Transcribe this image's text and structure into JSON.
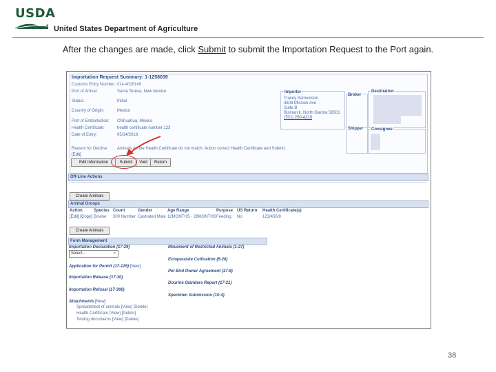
{
  "header": {
    "logo_text": "USDA",
    "agency": "United States Department of Agriculture",
    "caption_before": "After the changes are made, click ",
    "caption_link": "Submit",
    "caption_after": " to submit the Importation Request to the Port again."
  },
  "summary": {
    "title": "Importation Request Summary: 1-1258039",
    "customs": "Customs Entry Number: 014-4015149",
    "fields": [
      {
        "label": "Port of Arrival:",
        "value": "Santa Teresa, New Mexico"
      },
      {
        "label": "Status:",
        "value": "Initial"
      },
      {
        "label": "Country of Origin:",
        "value": "Mexico"
      },
      {
        "label": "Port of Embarkation:",
        "value": "Chihuahua, Mexico"
      },
      {
        "label": "Health Certificate:",
        "value": "health certificate number 123"
      },
      {
        "label": "Date of Entry:",
        "value": "05/14/2018"
      }
    ],
    "reason_label": "Reason for Decline:",
    "reason_text": "Animals on the Health Certificate do not match. Action correct Health Certificate and Submit.",
    "edit_link": "[Edit]"
  },
  "importer": {
    "label": "Importer",
    "lines": [
      "Tracey Samuelson",
      "3608 Mission Ave",
      "Suite B",
      "Bismarck, North Dakota 58501"
    ],
    "phone": "(701) 250-4210"
  },
  "parties": {
    "broker": "Broker",
    "destination": "Destination",
    "shipper": "Shipper",
    "consignee": "Consignee"
  },
  "buttons": {
    "edit": "Edit Information",
    "submit": "Submit",
    "void": "Void",
    "return": "Return",
    "create_animals_1": "Create Animals",
    "create_animals_2": "Create Animals"
  },
  "offline": {
    "title": "Off-Line Actions"
  },
  "animals": {
    "title": "Animal Groups",
    "headers": [
      "Action",
      "Species",
      "Count",
      "Gender",
      "Age Range",
      "Purpose",
      "US Return",
      "Health Certificate(s)"
    ],
    "row": [
      "[Edit] [Copy]",
      "Bovine",
      "300 Number",
      "Castrated Male",
      "12MONTHS - 28MONTHS",
      "Feeding",
      "No",
      "123/456/9"
    ]
  },
  "forms": {
    "title": "Form Management",
    "decl_label": "Importation Declaration (17-29)",
    "select_value": "Select...",
    "permit": "Application for Permit (17-129)",
    "new_link": "[New]",
    "release": "Importation Release (17-30)",
    "refusal": "Importation Refusal (17-360)",
    "right": [
      "Movement of Restricted Animals (1-27)",
      "Ectoparasite Cultivation (5-28)",
      "Pet Bird Owner Agreement (17-8)",
      "Dourine Glanders Report (17-21)",
      "Specimen Submission (10-4)"
    ],
    "attachments_label": "Attachments",
    "attachments": [
      "Spreadsheet of animals [View] [Delete]",
      "Health Certificate [View] [Delete]",
      "Testing documents [View] [Delete]"
    ]
  },
  "page_number": "38",
  "colors": {
    "annotation": "#d4302a",
    "usda_green": "#1e5a3c"
  }
}
